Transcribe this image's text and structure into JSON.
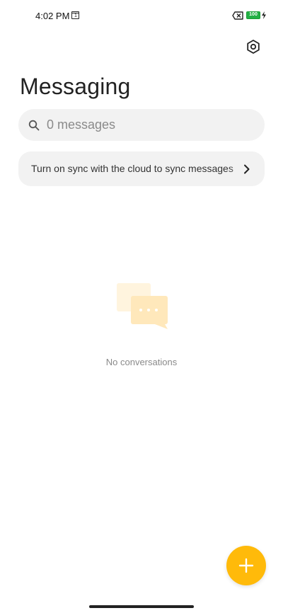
{
  "status_bar": {
    "time": "4:02 PM",
    "calendar_day": "1",
    "battery_level": "100",
    "icons": [
      "calendar-icon",
      "no-sim-icon",
      "battery-icon",
      "charging-bolt-icon"
    ]
  },
  "header": {
    "title": "Messaging",
    "settings_icon": "settings-icon"
  },
  "search": {
    "placeholder": "0 messages",
    "icon": "search-icon"
  },
  "sync_banner": {
    "text": "Turn on sync with the cloud to sync messages",
    "icon": "chevron-right-icon"
  },
  "empty_state": {
    "text": "No conversations",
    "icon": "chat-bubbles-icon"
  },
  "fab": {
    "icon": "plus-icon",
    "color": "#ffba0a"
  },
  "colors": {
    "accent": "#ffba0a",
    "battery": "#22b045",
    "surface": "#f2f2f2"
  }
}
